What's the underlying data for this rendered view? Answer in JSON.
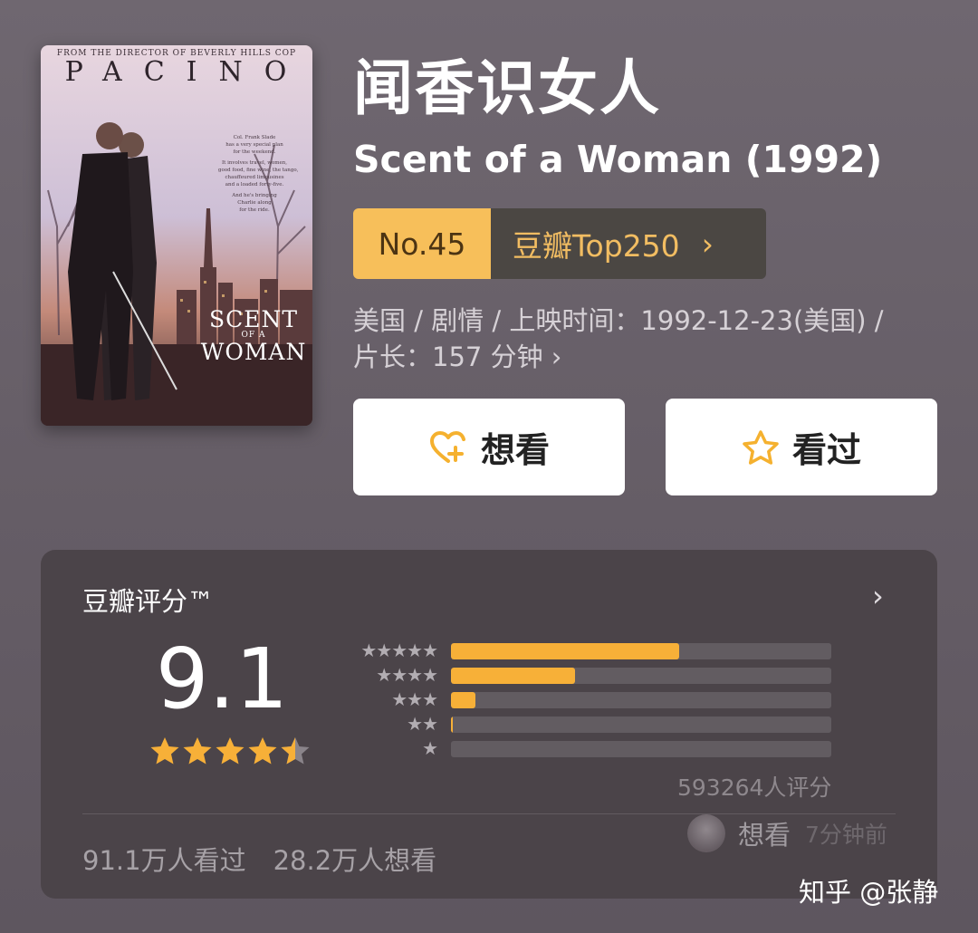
{
  "poster": {
    "top_line": "FROM THE DIRECTOR OF BEVERLY HILLS COP",
    "star_name": "PACINO",
    "tagline": [
      "Col. Frank Slade",
      "has a very special plan",
      "for the weekend.",
      "It involves travel, women,",
      "good food, fine wine, the tango,",
      "chauffeured limousines",
      "and a loaded forty-five.",
      "And he's bringing",
      "Charlie along",
      "for the ride."
    ],
    "logo_line1": "SCENT",
    "logo_line2": "OF A",
    "logo_line3": "WOMAN"
  },
  "movie": {
    "title_cn": "闻香识女人",
    "title_en": "Scent of a Woman (1992)",
    "rank_no": "No.45",
    "rank_list": "豆瓣Top250",
    "rank_arrow": "›",
    "meta_line1": "美国 / 剧情 / 上映时间：1992-12-23(美国) /",
    "meta_line2": "片长：157 分钟 ›"
  },
  "actions": {
    "want_label": "想看",
    "seen_label": "看过",
    "want_icon": "heart-plus-icon",
    "seen_icon": "star-outline-icon"
  },
  "rating": {
    "title": "豆瓣评分™",
    "arrow": "›",
    "score": "9.1",
    "score_stars": 4.5,
    "distribution": [
      {
        "stars": "★★★★★",
        "fraction": 0.6
      },
      {
        "stars": "★★★★",
        "fraction": 0.325
      },
      {
        "stars": "★★★",
        "fraction": 0.065
      },
      {
        "stars": "★★",
        "fraction": 0.005
      },
      {
        "stars": "★",
        "fraction": 0.0
      }
    ],
    "count": "593264人评分",
    "watched": "91.1万人看过",
    "wanted": "28.2万人想看",
    "ticker_action": "想看",
    "ticker_time": "7分钟前"
  },
  "watermark": "知乎 @张静",
  "colors": {
    "accent": "#f7b038",
    "badge_bg": "#f7bf5a",
    "card_bg": "#4b4449"
  }
}
